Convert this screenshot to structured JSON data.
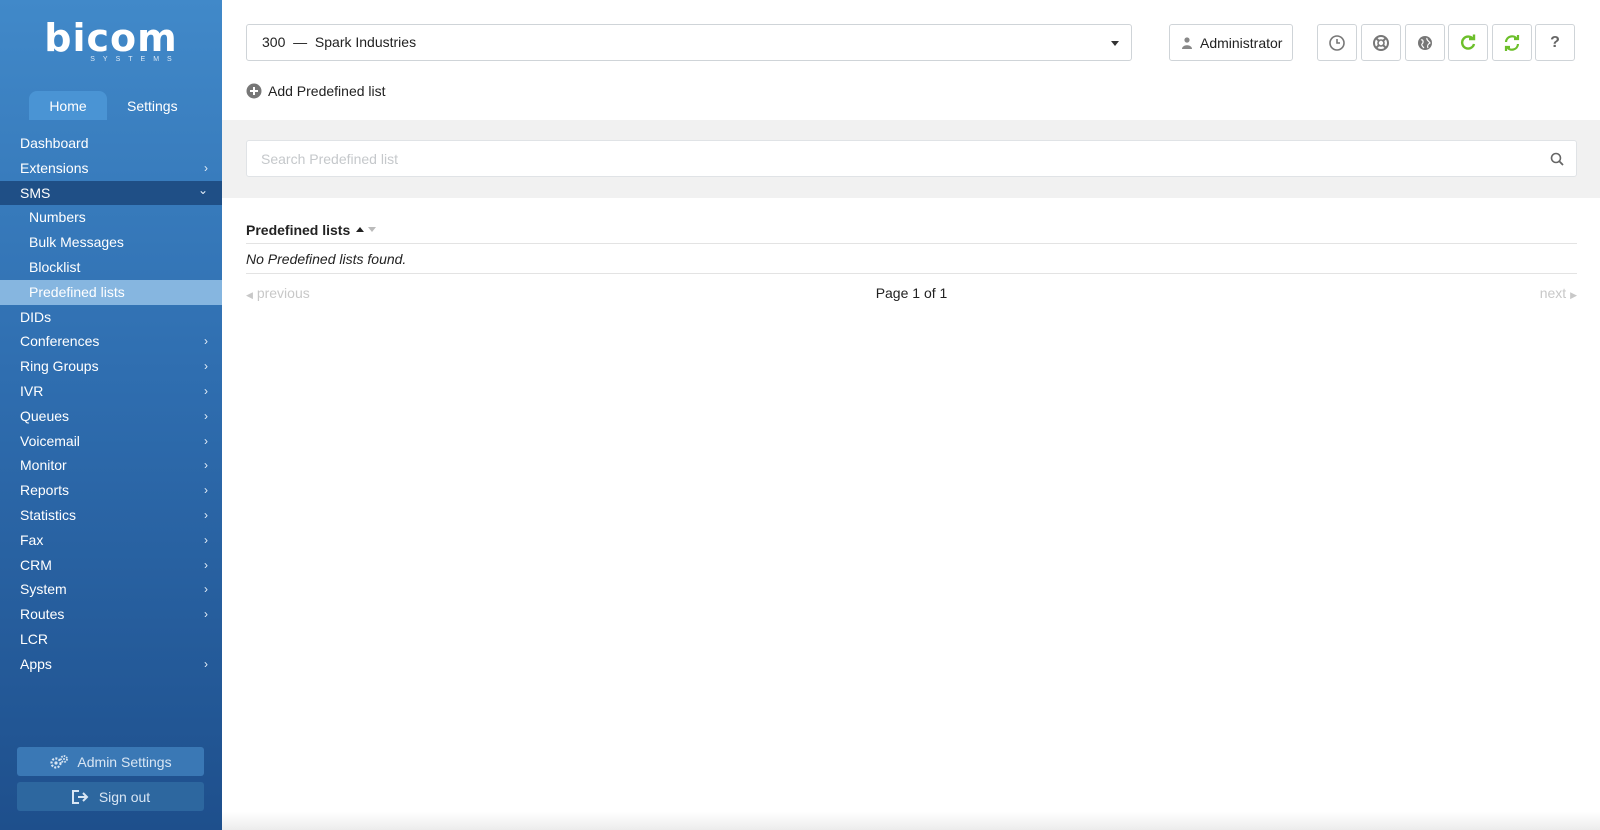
{
  "brand": {
    "name": "bicom",
    "sub": "SYSTEMS"
  },
  "topnav": {
    "home": "Home",
    "settings": "Settings"
  },
  "menu": [
    {
      "label": "Dashboard",
      "chevron": ""
    },
    {
      "label": "Extensions",
      "chevron": "›"
    },
    {
      "label": "SMS",
      "chevron": "⌄"
    },
    {
      "label": "Numbers",
      "chevron": ""
    },
    {
      "label": "Bulk Messages",
      "chevron": ""
    },
    {
      "label": "Blocklist",
      "chevron": ""
    },
    {
      "label": "Predefined lists",
      "chevron": ""
    },
    {
      "label": "DIDs",
      "chevron": ""
    },
    {
      "label": "Conferences",
      "chevron": "›"
    },
    {
      "label": "Ring Groups",
      "chevron": "›"
    },
    {
      "label": "IVR",
      "chevron": "›"
    },
    {
      "label": "Queues",
      "chevron": "›"
    },
    {
      "label": "Voicemail",
      "chevron": "›"
    },
    {
      "label": "Monitor",
      "chevron": "›"
    },
    {
      "label": "Reports",
      "chevron": "›"
    },
    {
      "label": "Statistics",
      "chevron": "›"
    },
    {
      "label": "Fax",
      "chevron": "›"
    },
    {
      "label": "CRM",
      "chevron": "›"
    },
    {
      "label": "System",
      "chevron": "›"
    },
    {
      "label": "Routes",
      "chevron": "›"
    },
    {
      "label": "LCR",
      "chevron": ""
    },
    {
      "label": "Apps",
      "chevron": "›"
    }
  ],
  "sidebar_buttons": {
    "admin_settings": "Admin Settings",
    "sign_out": "Sign out"
  },
  "header": {
    "tenant": "300  —  Spark Industries",
    "user": "Administrator",
    "help": "?"
  },
  "toolbar": {
    "add_label": "Add Predefined list"
  },
  "search": {
    "placeholder": "Search Predefined list"
  },
  "table": {
    "column": "Predefined lists",
    "empty_message": "No Predefined lists found."
  },
  "pager": {
    "previous": "previous",
    "info": "Page 1 of 1",
    "next": "next"
  },
  "colors": {
    "sidebar_top": "#4189c9",
    "sidebar_bottom": "#1e4f8c",
    "accent_green": "#6cbf2a"
  }
}
